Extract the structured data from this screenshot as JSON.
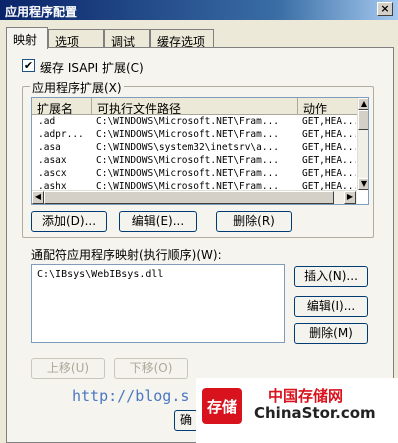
{
  "window": {
    "title": "应用程序配置",
    "close_glyph": "×"
  },
  "tabs": [
    {
      "label": "映射",
      "active": true
    },
    {
      "label": "选项",
      "active": false
    },
    {
      "label": "调试",
      "active": false
    },
    {
      "label": "缓存选项",
      "active": false
    }
  ],
  "cache_isapi": {
    "label": "缓存 ISAPI 扩展(C)",
    "checked": true,
    "check_glyph": "✔"
  },
  "extensions_group": {
    "label": "应用程序扩展(X)",
    "columns": [
      "扩展名",
      "可执行文件路径",
      "动作"
    ],
    "rows": [
      {
        "ext": ".ad",
        "path": "C:\\WINDOWS\\Microsoft.NET\\Fram...",
        "verbs": "GET,HEA..."
      },
      {
        "ext": ".adpr...",
        "path": "C:\\WINDOWS\\Microsoft.NET\\Fram...",
        "verbs": "GET,HEA..."
      },
      {
        "ext": ".asa",
        "path": "C:\\WINDOWS\\system32\\inetsrv\\a...",
        "verbs": "GET,HEA..."
      },
      {
        "ext": ".asax",
        "path": "C:\\WINDOWS\\Microsoft.NET\\Fram...",
        "verbs": "GET,HEA..."
      },
      {
        "ext": ".ascx",
        "path": "C:\\WINDOWS\\Microsoft.NET\\Fram...",
        "verbs": "GET,HEA..."
      },
      {
        "ext": ".ashx",
        "path": "C:\\WINDOWS\\Microsoft.NET\\Fram...",
        "verbs": "GET,HEA..."
      }
    ],
    "add_label": "添加(D)...",
    "edit_label": "编辑(E)...",
    "delete_label": "删除(R)"
  },
  "wildcard": {
    "label": "通配符应用程序映射(执行顺序)(W):",
    "items": [
      "C:\\IBsys\\WebIBsys.dll"
    ],
    "insert_label": "插入(N)...",
    "edit_label": "编辑(I)...",
    "delete_label": "删除(M)",
    "move_up_label": "上移(U)",
    "move_down_label": "下移(O)"
  },
  "footer": {
    "ok_label": "确",
    "watermark_url": "http://blog.s",
    "logo_cn": "中国存储网",
    "logo_en": "ChinaStor.com",
    "logo_mark_text": "存储",
    "brand_red": "#d8131e"
  }
}
